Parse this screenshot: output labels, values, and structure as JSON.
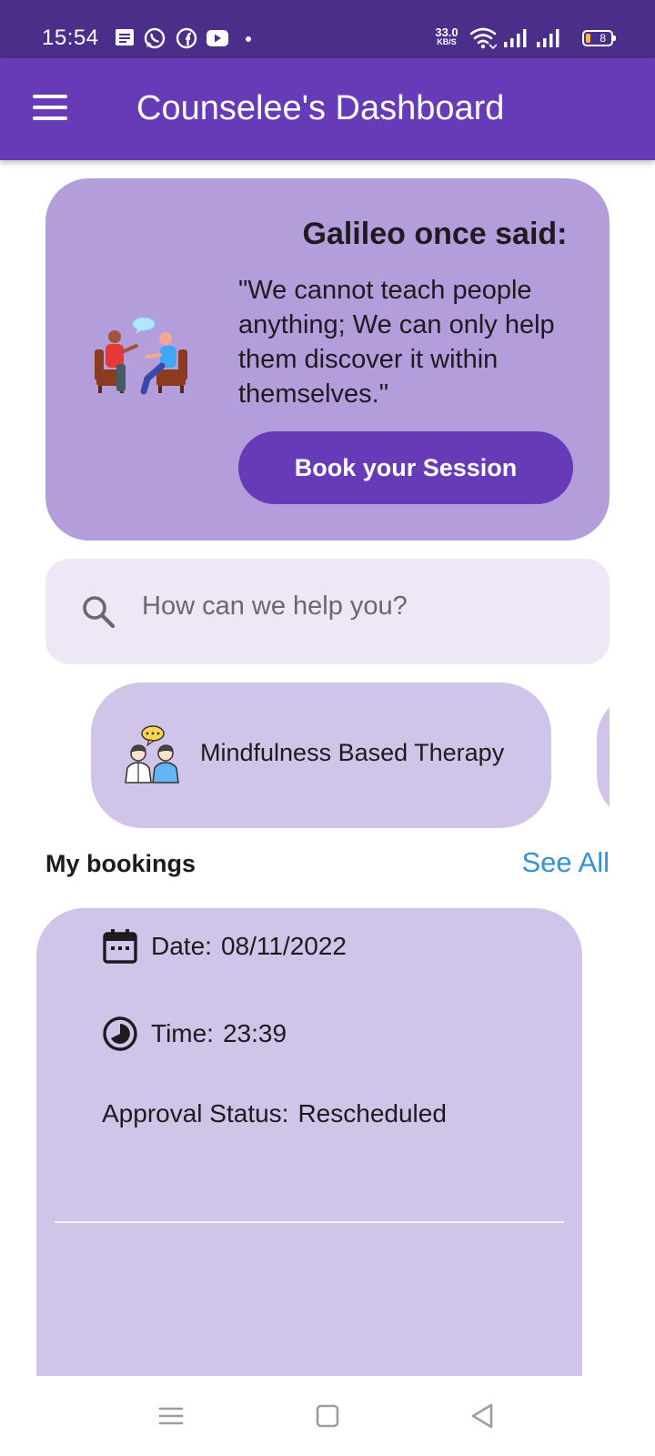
{
  "status_bar": {
    "time": "15:54",
    "notification_icons": [
      "message-icon",
      "whatsapp-icon",
      "facebook-icon",
      "youtube-icon"
    ],
    "net_speed_value": "33.0",
    "net_speed_unit": "KB/S",
    "battery_level": "8"
  },
  "app_bar": {
    "title": "Counselee's Dashboard"
  },
  "quote_card": {
    "title": "Galileo once said:",
    "quote": "\"We cannot teach people anything; We can only help them discover it within themselves.\"",
    "button_label": "Book your Session"
  },
  "search": {
    "placeholder": "How can we help you?"
  },
  "therapies": [
    {
      "label": "Mindfulness Based Therapy"
    }
  ],
  "bookings": {
    "section_title": "My bookings",
    "see_all_label": "See All",
    "items": [
      {
        "date_label": "Date:",
        "date_value": "08/11/2022",
        "time_label": "Time:",
        "time_value": "23:39",
        "status_label": "Approval Status:",
        "status_value": "Rescheduled"
      }
    ]
  },
  "colors": {
    "status_bar": "#4a2e8a",
    "app_bar": "#673ab7",
    "quote_card": "#b39ddb",
    "search_bg": "#ede7f6",
    "card_bg": "#d1c4e9",
    "link": "#2f93d8"
  }
}
